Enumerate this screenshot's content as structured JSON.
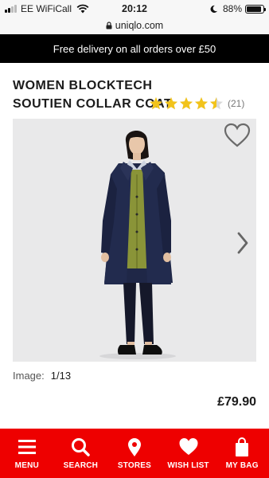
{
  "status_bar": {
    "carrier": "EE WiFiCall",
    "time": "20:12",
    "battery_text": "88%",
    "battery_level": 0.88
  },
  "browser": {
    "url": "uniqlo.com"
  },
  "promo": {
    "text": "Free delivery on all orders over £50"
  },
  "product": {
    "title": "WOMEN BLOCKTECH SOUTIEN COLLAR COAT",
    "rating": 4.5,
    "review_count": "(21)",
    "image_label": "Image:",
    "image_position": "1/13",
    "price": "£79.90"
  },
  "colors": {
    "brand_red": "#ee0000",
    "star": "#f2c31a",
    "coat": "#1f2747",
    "cardigan": "#8a9438"
  },
  "bottom_nav": {
    "items": [
      {
        "label": "MENU",
        "icon": "menu-icon"
      },
      {
        "label": "SEARCH",
        "icon": "search-icon"
      },
      {
        "label": "STORES",
        "icon": "location-pin-icon"
      },
      {
        "label": "WISH LIST",
        "icon": "heart-icon"
      },
      {
        "label": "MY BAG",
        "icon": "shopping-bag-icon"
      }
    ]
  }
}
